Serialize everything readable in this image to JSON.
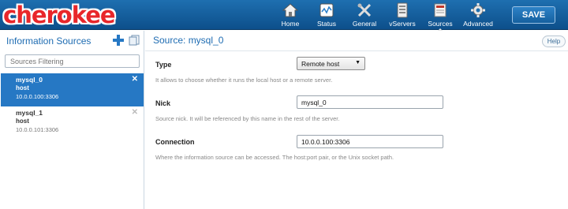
{
  "app": {
    "logo": "cherokee"
  },
  "nav": [
    {
      "label": "Home",
      "icon": "home-icon"
    },
    {
      "label": "Status",
      "icon": "status-icon"
    },
    {
      "label": "General",
      "icon": "general-icon"
    },
    {
      "label": "vServers",
      "icon": "vservers-icon"
    },
    {
      "label": "Sources",
      "icon": "sources-icon"
    },
    {
      "label": "Advanced",
      "icon": "advanced-icon"
    }
  ],
  "save_label": "SAVE",
  "sidebar": {
    "title": "Information Sources",
    "filter_placeholder": "Sources Filtering",
    "sources": [
      {
        "name": "mysql_0",
        "type": "host",
        "address": "10.0.0.100:3306",
        "selected": true
      },
      {
        "name": "mysql_1",
        "type": "host",
        "address": "10.0.0.101:3306",
        "selected": false
      }
    ]
  },
  "main": {
    "title": "Source: mysql_0",
    "help_label": "Help",
    "fields": {
      "type": {
        "label": "Type",
        "value": "Remote host",
        "desc": "It allows to choose whether it runs the local host or a remote server."
      },
      "nick": {
        "label": "Nick",
        "value": "mysql_0",
        "desc": "Source nick. It will be referenced by this name in the rest of the server."
      },
      "connection": {
        "label": "Connection",
        "value": "10.0.0.100:3306",
        "desc": "Where the information source can be accessed. The host:port pair, or the Unix socket path."
      }
    }
  },
  "colors": {
    "topbar": "#1e6fb0",
    "accent": "#2678c4",
    "logo": "#e8262a"
  }
}
